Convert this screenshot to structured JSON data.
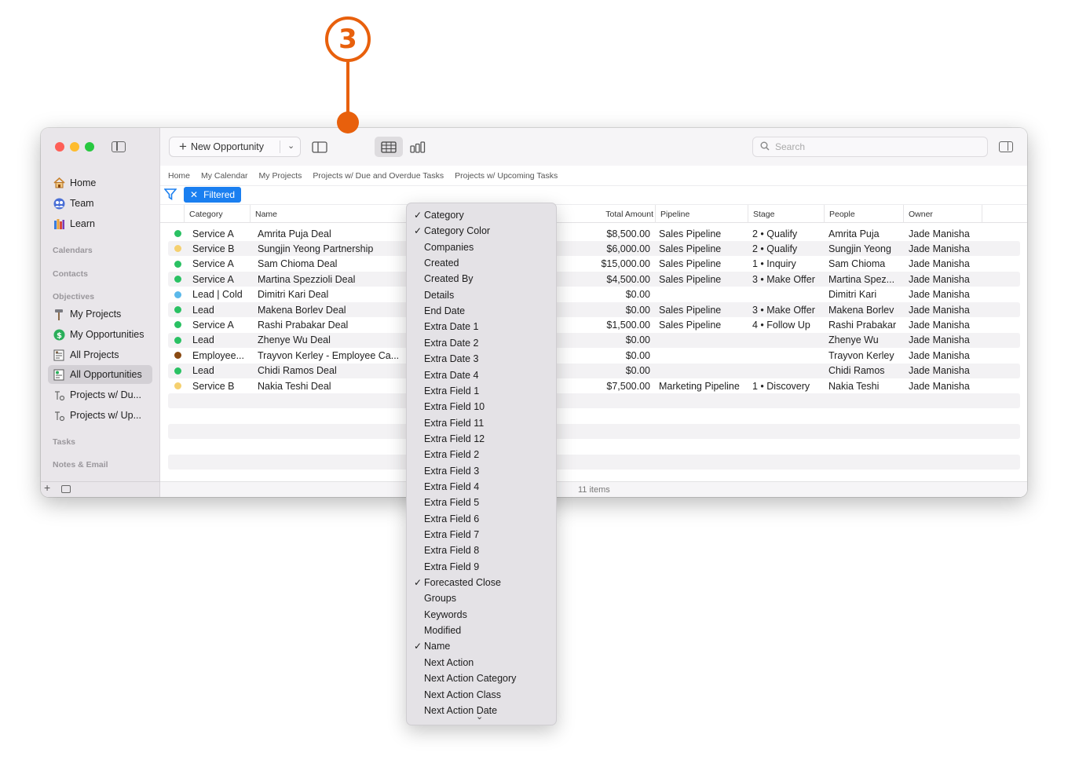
{
  "callout": {
    "number": "3"
  },
  "colors": {
    "accent": "#1a7ff0",
    "callout": "#e8600c"
  },
  "sidebar": {
    "items": [
      {
        "label": "Home",
        "icon": "home-icon"
      },
      {
        "label": "Team",
        "icon": "team-icon"
      },
      {
        "label": "Learn",
        "icon": "books-icon"
      }
    ],
    "sections": [
      "Calendars",
      "Contacts",
      "Objectives",
      "Tasks",
      "Notes & Email"
    ],
    "objectives": [
      {
        "label": "My Projects",
        "icon": "hammer-icon"
      },
      {
        "label": "My Opportunities",
        "icon": "dollar-icon"
      },
      {
        "label": "All Projects",
        "icon": "project-sheet-icon"
      },
      {
        "label": "All Opportunities",
        "icon": "opportunity-sheet-icon"
      },
      {
        "label": "Projects w/ Du...",
        "icon": "task-icon"
      },
      {
        "label": "Projects w/ Up...",
        "icon": "task-icon"
      }
    ]
  },
  "toolbar": {
    "new_label": "New Opportunity",
    "search_placeholder": "Search"
  },
  "breadcrumbs": [
    "Home",
    "My Calendar",
    "My Projects",
    "Projects w/ Due and Overdue Tasks",
    "Projects w/ Upcoming Tasks"
  ],
  "filter": {
    "label": "Filtered"
  },
  "table": {
    "columns": [
      "Category",
      "Name",
      "Total Amount",
      "Pipeline",
      "Stage",
      "People",
      "Owner"
    ],
    "rows": [
      {
        "color": "#2ac163",
        "category": "Service A",
        "name": "Amrita Puja Deal",
        "amount": "$8,500.00",
        "pipeline": "Sales Pipeline",
        "stage": "2 • Qualify",
        "people": "Amrita Puja",
        "owner": "Jade Manisha"
      },
      {
        "color": "#f5d06f",
        "category": "Service B",
        "name": "Sungjin Yeong Partnership",
        "amount": "$6,000.00",
        "pipeline": "Sales Pipeline",
        "stage": "2 • Qualify",
        "people": "Sungjin Yeong",
        "owner": "Jade Manisha"
      },
      {
        "color": "#2ac163",
        "category": "Service A",
        "name": "Sam Chioma Deal",
        "amount": "$15,000.00",
        "pipeline": "Sales Pipeline",
        "stage": "1 • Inquiry",
        "people": "Sam Chioma",
        "owner": "Jade Manisha"
      },
      {
        "color": "#2ac163",
        "category": "Service A",
        "name": "Martina Spezzioli Deal",
        "amount": "$4,500.00",
        "pipeline": "Sales Pipeline",
        "stage": "3 • Make Offer",
        "people": "Martina Spez...",
        "owner": "Jade Manisha"
      },
      {
        "color": "#5ab8ea",
        "category": "Lead | Cold",
        "name": "Dimitri Kari Deal",
        "amount": "$0.00",
        "pipeline": "",
        "stage": "",
        "people": "Dimitri Kari",
        "owner": "Jade Manisha"
      },
      {
        "color": "#2ac163",
        "category": "Lead",
        "name": "Makena Borlev Deal",
        "amount": "$0.00",
        "pipeline": "Sales Pipeline",
        "stage": "3 • Make Offer",
        "people": "Makena Borlev",
        "owner": "Jade Manisha"
      },
      {
        "color": "#2ac163",
        "category": "Service A",
        "name": "Rashi Prabakar Deal",
        "amount": "$1,500.00",
        "pipeline": "Sales Pipeline",
        "stage": "4 • Follow Up",
        "people": "Rashi Prabakar",
        "owner": "Jade Manisha"
      },
      {
        "color": "#2ac163",
        "category": "Lead",
        "name": "Zhenye Wu Deal",
        "amount": "$0.00",
        "pipeline": "",
        "stage": "",
        "people": "Zhenye Wu",
        "owner": "Jade Manisha"
      },
      {
        "color": "#8a4a12",
        "category": "Employee...",
        "name": "Trayvon Kerley - Employee Ca...",
        "amount": "$0.00",
        "pipeline": "",
        "stage": "",
        "people": "Trayvon Kerley",
        "owner": "Jade Manisha"
      },
      {
        "color": "#2ac163",
        "category": "Lead",
        "name": "Chidi Ramos Deal",
        "amount": "$0.00",
        "pipeline": "",
        "stage": "",
        "people": "Chidi Ramos",
        "owner": "Jade Manisha"
      },
      {
        "color": "#f5d06f",
        "category": "Service B",
        "name": "Nakia Teshi Deal",
        "amount": "$7,500.00",
        "pipeline": "Marketing Pipeline",
        "stage": "1 • Discovery",
        "people": "Nakia Teshi",
        "owner": "Jade Manisha"
      }
    ],
    "status": "11 items"
  },
  "menu": {
    "check_glyph": "✓",
    "items": [
      {
        "label": "Category",
        "checked": true
      },
      {
        "label": "Category Color",
        "checked": true
      },
      {
        "label": "Companies",
        "checked": false
      },
      {
        "label": "Created",
        "checked": false
      },
      {
        "label": "Created By",
        "checked": false
      },
      {
        "label": "Details",
        "checked": false
      },
      {
        "label": "End Date",
        "checked": false
      },
      {
        "label": "Extra Date 1",
        "checked": false
      },
      {
        "label": "Extra Date 2",
        "checked": false
      },
      {
        "label": "Extra Date 3",
        "checked": false
      },
      {
        "label": "Extra Date 4",
        "checked": false
      },
      {
        "label": "Extra Field 1",
        "checked": false
      },
      {
        "label": "Extra Field 10",
        "checked": false
      },
      {
        "label": "Extra Field 11",
        "checked": false
      },
      {
        "label": "Extra Field 12",
        "checked": false
      },
      {
        "label": "Extra Field 2",
        "checked": false
      },
      {
        "label": "Extra Field 3",
        "checked": false
      },
      {
        "label": "Extra Field 4",
        "checked": false
      },
      {
        "label": "Extra Field 5",
        "checked": false
      },
      {
        "label": "Extra Field 6",
        "checked": false
      },
      {
        "label": "Extra Field 7",
        "checked": false
      },
      {
        "label": "Extra Field 8",
        "checked": false
      },
      {
        "label": "Extra Field 9",
        "checked": false
      },
      {
        "label": "Forecasted Close",
        "checked": true
      },
      {
        "label": "Groups",
        "checked": false
      },
      {
        "label": "Keywords",
        "checked": false
      },
      {
        "label": "Modified",
        "checked": false
      },
      {
        "label": "Name",
        "checked": true
      },
      {
        "label": "Next Action",
        "checked": false
      },
      {
        "label": "Next Action Category",
        "checked": false
      },
      {
        "label": "Next Action Class",
        "checked": false
      },
      {
        "label": "Next Action Date",
        "checked": false
      }
    ]
  }
}
